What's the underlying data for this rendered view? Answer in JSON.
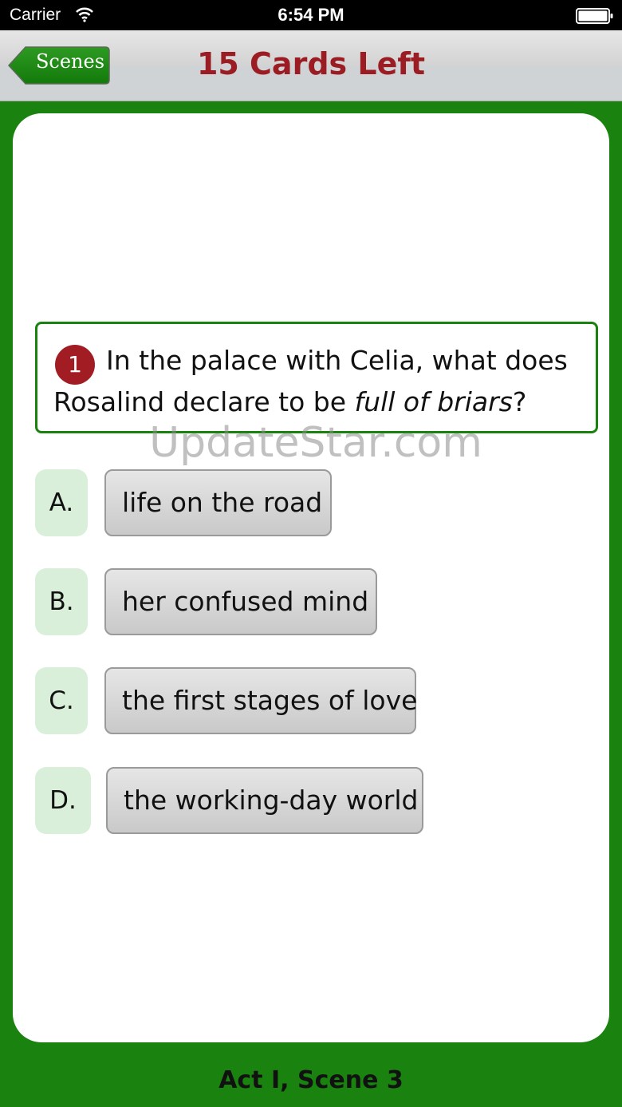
{
  "status_bar": {
    "carrier": "Carrier",
    "time": "6:54 PM"
  },
  "nav": {
    "back_label": "Scenes",
    "title": "15 Cards Left"
  },
  "question": {
    "number": "1",
    "line1": "In the palace with Celia, what does",
    "line2_prefix": "Rosalind declare to be ",
    "line2_italic": "full of briars",
    "line2_suffix": "?"
  },
  "options": [
    {
      "letter": "A.",
      "text": "life on the road"
    },
    {
      "letter": "B.",
      "text": "her confused mind"
    },
    {
      "letter": "C.",
      "text": "the first stages of love"
    },
    {
      "letter": "D.",
      "text": "the working-day world"
    }
  ],
  "watermark": "UpdateStar.com",
  "footer": "Act I, Scene 3",
  "colors": {
    "green": "#1a820f",
    "title_red": "#9b1c22",
    "badge_red": "#a11d23",
    "option_letter_bg": "#d9efd9"
  }
}
